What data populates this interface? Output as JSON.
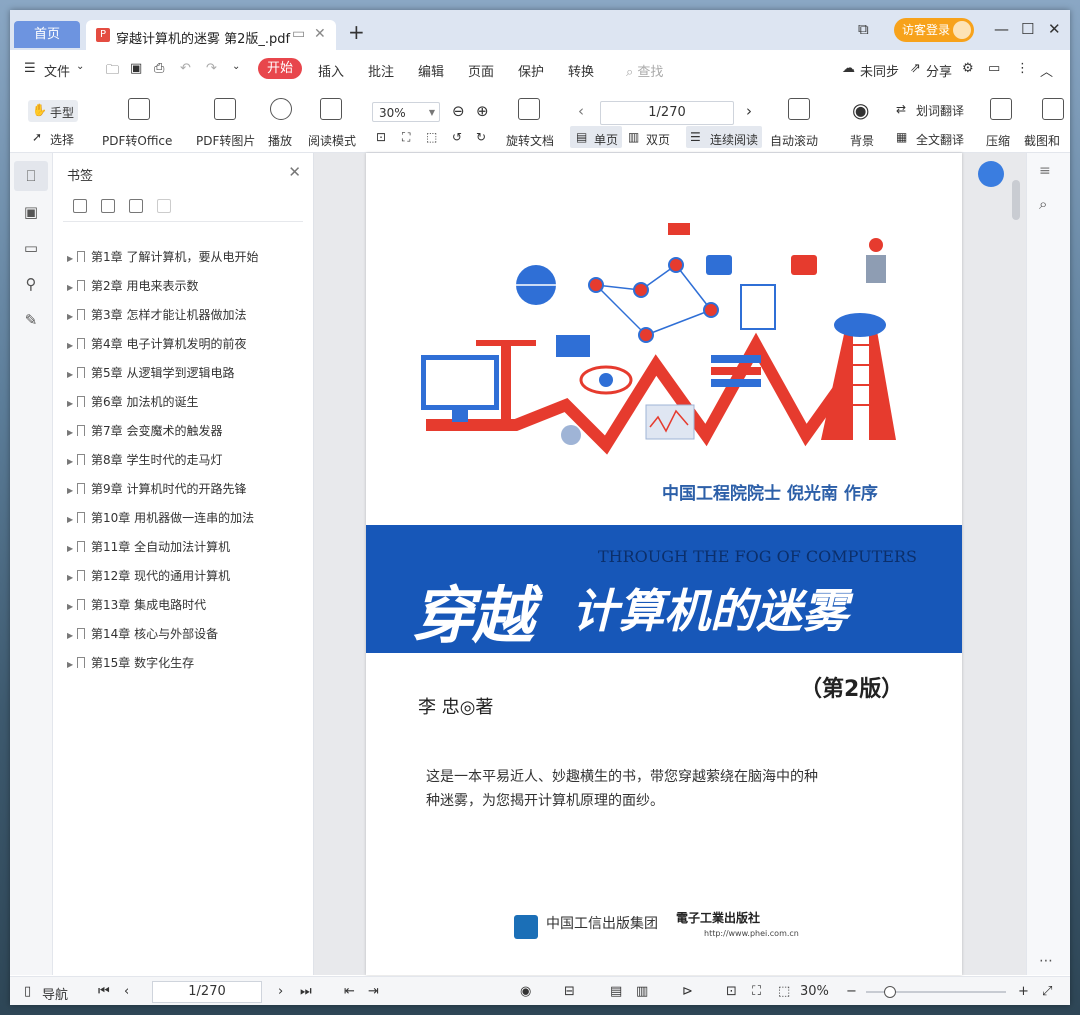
{
  "tabs": {
    "home": "首页",
    "doc_title": "穿越计算机的迷雾 第2版_.pdf",
    "new_tab": "+"
  },
  "account": {
    "login": "访客登录"
  },
  "menu": {
    "file": "文件",
    "start": "开始",
    "items": [
      "插入",
      "批注",
      "编辑",
      "页面",
      "保护",
      "转换"
    ],
    "search_placeholder": "查找",
    "sync": "未同步",
    "share": "分享"
  },
  "toolbar": {
    "hand": "手型",
    "select": "选择",
    "pdf_to_office": "PDF转Office",
    "pdf_to_image": "PDF转图片",
    "play": "播放",
    "read_mode": "阅读模式",
    "zoom": "30%",
    "rotate": "旋转文档",
    "page_value": "1/270",
    "single": "单页",
    "double": "双页",
    "continuous": "连续阅读",
    "auto_scroll": "自动滚动",
    "background": "背景",
    "word_translate": "划词翻译",
    "full_translate": "全文翻译",
    "compress": "压缩",
    "screenshot": "截图和"
  },
  "bookmarks": {
    "title": "书签",
    "items": [
      "第1章  了解计算机，要从电开始",
      "第2章  用电来表示数",
      "第3章  怎样才能让机器做加法",
      "第4章  电子计算机发明的前夜",
      "第5章  从逻辑学到逻辑电路",
      "第6章  加法机的诞生",
      "第7章  会变魔术的触发器",
      "第8章  学生时代的走马灯",
      "第9章  计算机时代的开路先锋",
      "第10章  用机器做一连串的加法",
      "第11章  全自动加法计算机",
      "第12章  现代的通用计算机",
      "第13章  集成电路时代",
      "第14章  核心与外部设备",
      "第15章  数字化生存"
    ]
  },
  "cover": {
    "preface": "中国工程院院士  倪光南  作序",
    "title_en": "THROUGH THE FOG OF COMPUTERS",
    "title_cn_1": "穿越",
    "title_cn_2": "计算机的迷雾",
    "edition": "（第2版）",
    "author": "李  忠◎著",
    "desc_1": "这是一本平易近人、妙趣横生的书，带您穿越萦绕在脑海中的种",
    "desc_2": "种迷雾，为您揭开计算机原理的面纱。",
    "publisher_1": "中国工信出版集团",
    "publisher_2": "電子工業出版社",
    "publisher_url": "http://www.phei.com.cn"
  },
  "status": {
    "nav": "导航",
    "page_value": "1/270",
    "zoom": "30%"
  },
  "colors": {
    "accent": "#e8464c",
    "home_tab": "#6d94e0",
    "cover_band": "#1757b8",
    "cover_text": "#2c5fa8"
  }
}
